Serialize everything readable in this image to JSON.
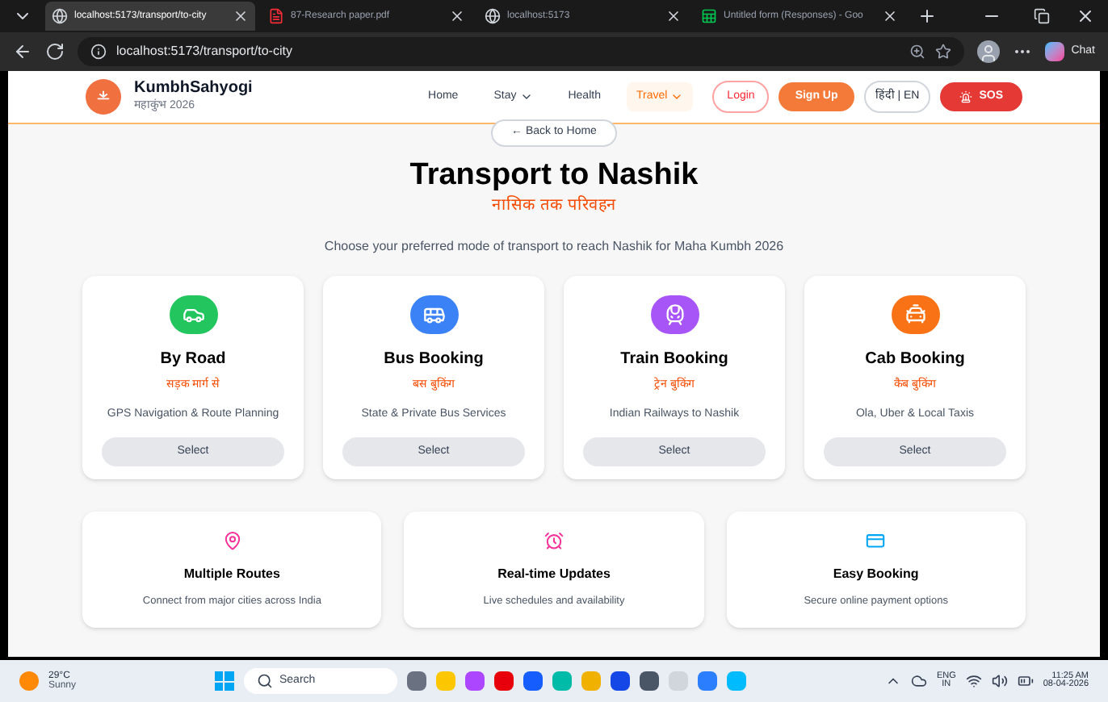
{
  "browser": {
    "tabs": [
      {
        "title": "localhost:5173/transport/to-city",
        "selected": true,
        "kind": "web"
      },
      {
        "title": "87-Research paper.pdf",
        "selected": false,
        "kind": "pdf"
      },
      {
        "title": "localhost:5173",
        "selected": false,
        "kind": "web"
      },
      {
        "title": "Untitled form (Responses) - Goo",
        "selected": false,
        "kind": "sheet"
      }
    ],
    "address": "localhost:5173/transport/to-city",
    "chat": "Chat"
  },
  "header": {
    "brand": "KumbhSahyogi",
    "tagline": "महाकुंभ 2026",
    "nav": [
      {
        "label": "Home",
        "dropdown": false,
        "selected": false
      },
      {
        "label": "Stay",
        "dropdown": true,
        "selected": false
      },
      {
        "label": "Health",
        "dropdown": false,
        "selected": false
      },
      {
        "label": "Travel",
        "dropdown": true,
        "selected": true
      }
    ],
    "login": "Login",
    "signup": "Sign Up",
    "language": "हिंदी | EN",
    "sos": "SOS"
  },
  "back": "← Back to Home",
  "title": "Transport to Nashik",
  "subtitle": "नासिक तक परिवहन",
  "description": "Choose your preferred mode of transport to reach Nashik for Maha Kumbh 2026",
  "options": [
    {
      "kind": "car",
      "title": "By Road",
      "hindi": "सड़क मार्ग से",
      "description": "GPS Navigation & Route Planning",
      "button": "Select",
      "color": "#22c55e"
    },
    {
      "kind": "bus",
      "title": "Bus Booking",
      "hindi": "बस बुकिंग",
      "description": "State & Private Bus Services",
      "button": "Select",
      "color": "#3b82f6"
    },
    {
      "kind": "train",
      "title": "Train Booking",
      "hindi": "ट्रेन बुकिंग",
      "description": "Indian Railways to Nashik",
      "button": "Select",
      "color": "#a855f7"
    },
    {
      "kind": "taxi",
      "title": "Cab Booking",
      "hindi": "कैब बुकिंग",
      "description": "Ola, Uber & Local Taxis",
      "button": "Select",
      "color": "#f97316"
    }
  ],
  "features": [
    {
      "kind": "pin",
      "title": "Multiple Routes",
      "description": "Connect from major cities across India"
    },
    {
      "kind": "alarm",
      "title": "Real-time Updates",
      "description": "Live schedules and availability"
    },
    {
      "kind": "card",
      "title": "Easy Booking",
      "description": "Secure online payment options"
    }
  ],
  "taskbar": {
    "temperature": "29°C",
    "weather": "Sunny",
    "search": "Search",
    "language": "ENG",
    "region": "IN",
    "time": "11:25 AM",
    "date": "08-04-2026"
  }
}
